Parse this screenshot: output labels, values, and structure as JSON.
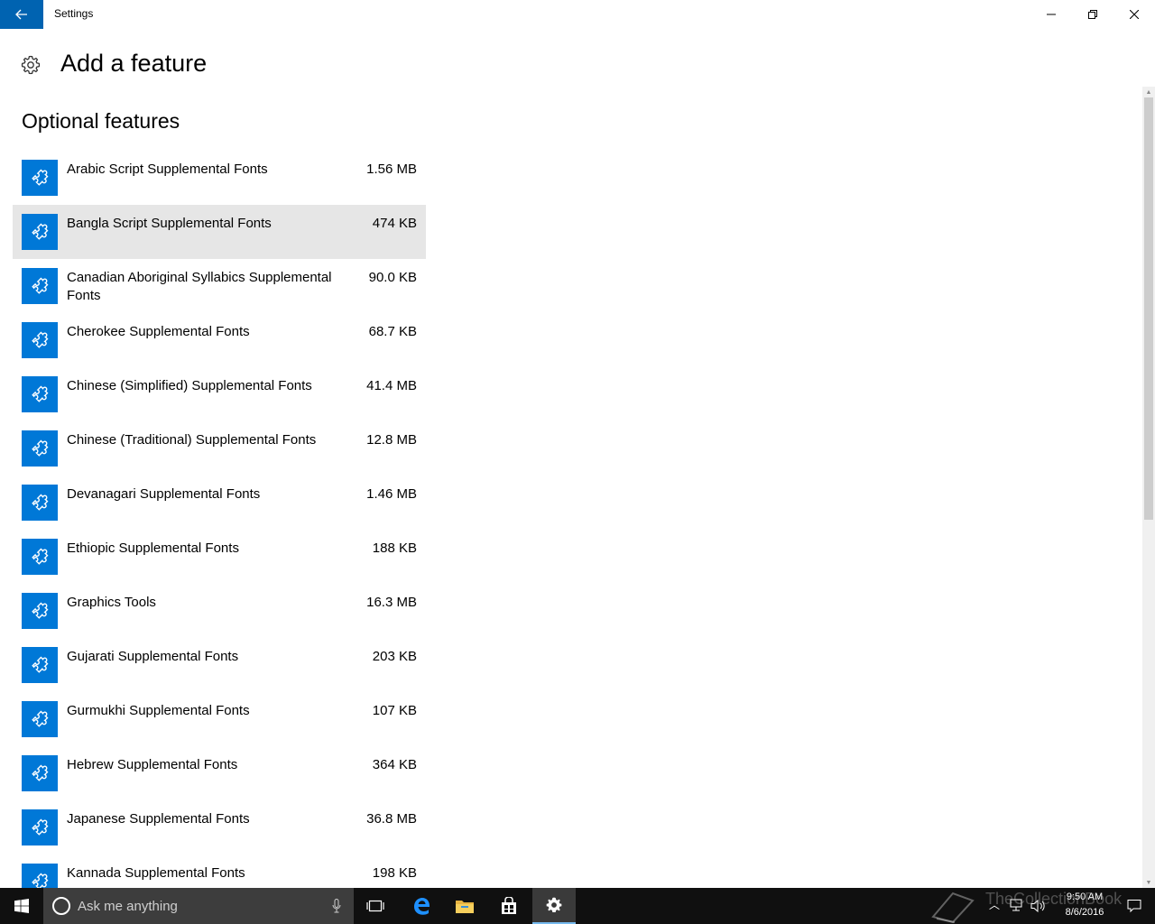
{
  "window": {
    "title": "Settings"
  },
  "header": {
    "page_title": "Add a feature",
    "section_title": "Optional features"
  },
  "features": [
    {
      "name": "Arabic Script Supplemental Fonts",
      "size": "1.56 MB"
    },
    {
      "name": "Bangla Script Supplemental Fonts",
      "size": "474 KB"
    },
    {
      "name": "Canadian Aboriginal Syllabics Supplemental Fonts",
      "size": "90.0 KB"
    },
    {
      "name": "Cherokee Supplemental Fonts",
      "size": "68.7 KB"
    },
    {
      "name": "Chinese (Simplified) Supplemental Fonts",
      "size": "41.4 MB"
    },
    {
      "name": "Chinese (Traditional) Supplemental Fonts",
      "size": "12.8 MB"
    },
    {
      "name": "Devanagari Supplemental Fonts",
      "size": "1.46 MB"
    },
    {
      "name": "Ethiopic Supplemental Fonts",
      "size": "188 KB"
    },
    {
      "name": "Graphics Tools",
      "size": "16.3 MB"
    },
    {
      "name": "Gujarati Supplemental Fonts",
      "size": "203 KB"
    },
    {
      "name": "Gurmukhi Supplemental Fonts",
      "size": "107 KB"
    },
    {
      "name": "Hebrew Supplemental Fonts",
      "size": "364 KB"
    },
    {
      "name": "Japanese Supplemental Fonts",
      "size": "36.8 MB"
    },
    {
      "name": "Kannada Supplemental Fonts",
      "size": "198 KB"
    }
  ],
  "taskbar": {
    "search_placeholder": "Ask me anything",
    "time": "9:50 AM",
    "date": "8/6/2016",
    "watermark": "TheCollectionBook"
  },
  "colors": {
    "accent": "#0078d7",
    "back_button": "#0063b1",
    "hover_row": "#e6e6e6",
    "taskbar": "#101010"
  },
  "icons": {
    "back": "arrow-left-icon",
    "feature": "puzzle-piece-icon",
    "header": "gear-icon"
  }
}
